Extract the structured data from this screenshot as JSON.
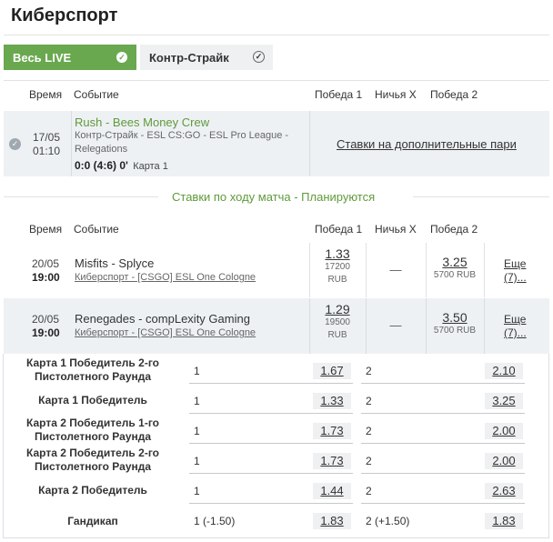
{
  "page": {
    "title": "Киберспорт"
  },
  "filters": {
    "all_live": "Весь LIVE",
    "counter_strike": "Контр-Страйк"
  },
  "table_header": {
    "time": "Время",
    "event": "Событие",
    "win1": "Победа 1",
    "draw": "Ничья X",
    "win2": "Победа 2"
  },
  "live_match": {
    "date": "17/05",
    "time": "01:10",
    "teams": "Rush - Bees Money Crew",
    "league": "Контр-Страйк - ESL CS:GO - ESL Pro League - Relegations",
    "score": "0:0 (4:6) 0'",
    "map": "Карта 1",
    "extra_link": "Ставки на дополнительные пари"
  },
  "planned_banner": "Ставки по ходу матча - Планируются",
  "matches": [
    {
      "date": "20/05",
      "time": "19:00",
      "teams": "Misfits - Splyce",
      "league": "Киберспорт - [CSGO] ESL One Cologne",
      "win1": "1.33",
      "win1_amount": "17200",
      "win1_currency": "RUB",
      "draw": "—",
      "win2": "3.25",
      "win2_amount": "5700 RUB",
      "more": "Еще (7)..."
    },
    {
      "date": "20/05",
      "time": "19:00",
      "teams": "Renegades - compLexity Gaming",
      "league": "Киберспорт - [CSGO] ESL One Cologne",
      "win1": "1.29",
      "win1_amount": "19500",
      "win1_currency": "RUB",
      "draw": "—",
      "win2": "3.50",
      "win2_amount": "5700 RUB",
      "more": "Еще (7)..."
    }
  ],
  "markets": [
    {
      "label": "Карта 1 Победитель 2-го Пистолетного Раунда",
      "o1": "1",
      "v1": "1.67",
      "o2": "2",
      "v2": "2.10"
    },
    {
      "label": "Карта 1 Победитель",
      "o1": "1",
      "v1": "1.33",
      "o2": "2",
      "v2": "3.25"
    },
    {
      "label": "Карта 2 Победитель 1-го Пистолетного Раунда",
      "o1": "1",
      "v1": "1.73",
      "o2": "2",
      "v2": "2.00"
    },
    {
      "label": "Карта 2 Победитель 2-го Пистолетного Раунда",
      "o1": "1",
      "v1": "1.73",
      "o2": "2",
      "v2": "2.00"
    },
    {
      "label": "Карта 2 Победитель",
      "o1": "1",
      "v1": "1.44",
      "o2": "2",
      "v2": "2.63"
    },
    {
      "label": "Гандикап",
      "o1": "1 (-1.50)",
      "v1": "1.83",
      "o2": "2 (+1.50)",
      "v2": "1.83"
    }
  ],
  "colors": {
    "accent": "#6aa84f",
    "green_text": "#5f9a3a",
    "panel": "#eef1f4"
  },
  "icons": {
    "check": "check-circle-icon"
  }
}
